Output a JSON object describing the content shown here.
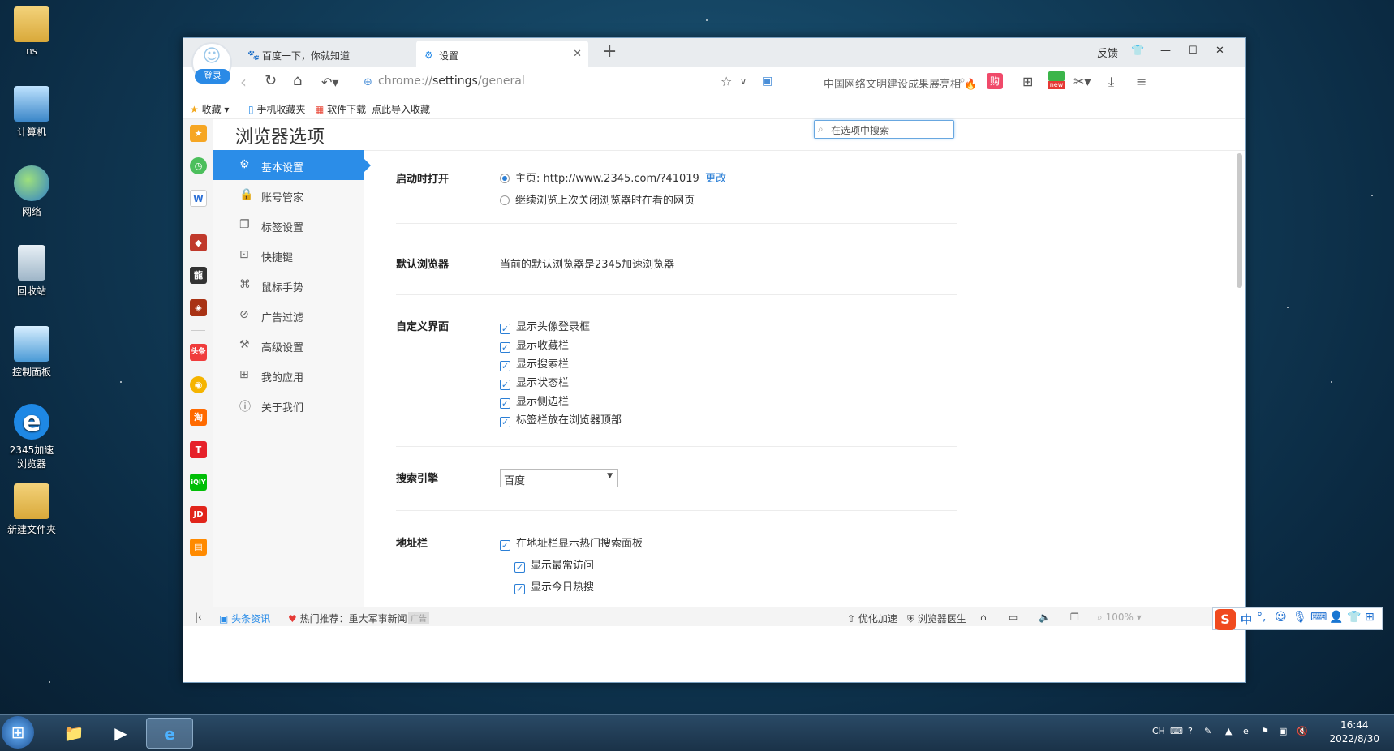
{
  "desktop": {
    "icons": [
      {
        "label": "ns"
      },
      {
        "label": "计算机"
      },
      {
        "label": "网络"
      },
      {
        "label": "回收站"
      },
      {
        "label": "控制面板"
      },
      {
        "label": "2345加速浏览器"
      },
      {
        "label": "新建文件夹"
      }
    ]
  },
  "browser": {
    "login_label": "登录",
    "tabs": [
      {
        "label": "百度一下，你就知道"
      },
      {
        "label": "设置"
      }
    ],
    "feedback_label": "反馈",
    "address": {
      "prefix": "chrome://",
      "bold": "settings",
      "suffix": "/general"
    },
    "news_ticker": "中国网络文明建设成果展亮相",
    "new_badge": "new",
    "bookmarks": [
      {
        "label": "收藏"
      },
      {
        "label": "手机收藏夹"
      },
      {
        "label": "软件下载"
      },
      {
        "label": "点此导入收藏"
      }
    ],
    "sidebar_labels": {
      "toutiao": "头条",
      "taobao": "淘",
      "iqiyi": "iQIY",
      "jd": "JD"
    }
  },
  "settings": {
    "page_title": "浏览器选项",
    "search_placeholder": "在选项中搜索",
    "menu": [
      {
        "label": "基本设置",
        "active": true
      },
      {
        "label": "账号管家"
      },
      {
        "label": "标签设置"
      },
      {
        "label": "快捷键"
      },
      {
        "label": "鼠标手势"
      },
      {
        "label": "广告过滤"
      },
      {
        "label": "高级设置"
      },
      {
        "label": "我的应用"
      },
      {
        "label": "关于我们"
      }
    ],
    "startup": {
      "title": "启动时打开",
      "homepage": "主页: http://www.2345.com/?41019",
      "change": "更改",
      "continue": "继续浏览上次关闭浏览器时在看的网页"
    },
    "default_browser": {
      "title": "默认浏览器",
      "text": "当前的默认浏览器是2345加速浏览器"
    },
    "custom_ui": {
      "title": "自定义界面",
      "options": [
        "显示头像登录框",
        "显示收藏栏",
        "显示搜索栏",
        "显示状态栏",
        "显示侧边栏",
        "标签栏放在浏览器顶部"
      ]
    },
    "search_engine": {
      "title": "搜索引擎",
      "selected": "百度"
    },
    "address_bar": {
      "title": "地址栏",
      "option": "在地址栏显示热门搜索面板",
      "sub_options": [
        "显示最常访问",
        "显示今日热搜"
      ]
    }
  },
  "statusbar": {
    "news": "头条资讯",
    "hot": "热门推荐：重大军事新闻",
    "ad": "广告",
    "optimize": "优化加速",
    "doctor": "浏览器医生",
    "zoom": "100%"
  },
  "ime": {
    "lang": "中"
  },
  "taskbar": {
    "lang": "CH",
    "time": "16:44",
    "date": "2022/8/30"
  }
}
